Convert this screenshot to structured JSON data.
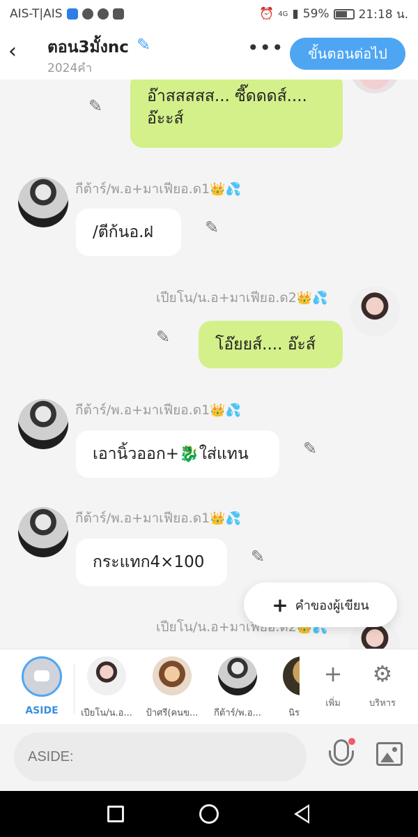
{
  "status_bar": {
    "carrier": "AIS-T|AIS",
    "network": "4G",
    "battery": "59%",
    "time": "21:18 น."
  },
  "header": {
    "title": "ตอน3มั้งnc",
    "word_count": "2024คำ",
    "more": "•••",
    "next_button": "ขั้นตอนต่อไป"
  },
  "messages": [
    {
      "side": "right",
      "text_line1": "อ๊าสสสสส... ซี๊ดดดส์....",
      "text_line2": "อ๊ะะส์"
    },
    {
      "side": "left",
      "sender": "กีต้าร์/พ.อ+มาเฟียอ.ด1",
      "text": "/ตีก้นอ.ฝ"
    },
    {
      "side": "right",
      "sender": "เปียโน/น.อ+มาเฟียอ.ด2",
      "text": "โอ๊ยยส์.... อ๊ะส์"
    },
    {
      "side": "left",
      "sender": "กีต้าร์/พ.อ+มาเฟียอ.ด1",
      "text": "เอานิ้วออก+🐉ใส่แทน"
    },
    {
      "side": "left",
      "sender": "กีต้าร์/พ.อ+มาเฟียอ.ด1",
      "text": "กระแทก4×100"
    },
    {
      "side": "right",
      "sender": "เปียโน/น.อ+มาเฟียอ.ด2"
    }
  ],
  "sender_emojis": "👑💦",
  "fab": {
    "plus": "+",
    "label": "คำของผู้เขียน"
  },
  "character_bar": {
    "aside_label": "ASIDE",
    "characters": [
      {
        "name": "เปียโน/น.อ..."
      },
      {
        "name": "ป้าศรี(คนข..."
      },
      {
        "name": "กีต้าร์/พ.อ..."
      },
      {
        "name": "นิร"
      }
    ],
    "add_label": "เพิ่ม",
    "add_icon": "+",
    "manage_label": "บริหาร",
    "manage_icon": "⚙"
  },
  "input": {
    "placeholder": "ASIDE:"
  },
  "colors": {
    "accent": "#4ea6f3",
    "green_bubble": "#d4f08a",
    "white_bubble": "#ffffff"
  }
}
